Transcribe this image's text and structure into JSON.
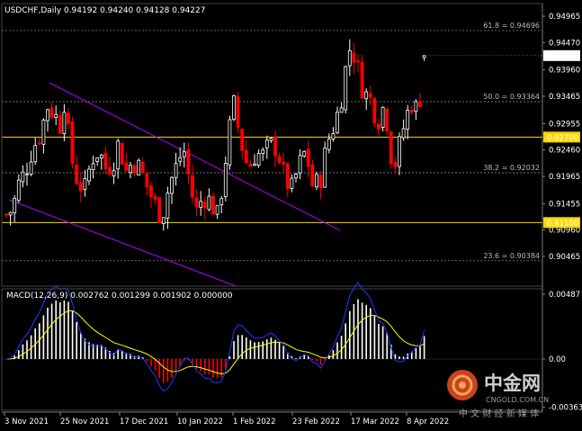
{
  "header": {
    "symbol_label": "USDCHF,Daily",
    "open": "0.94192",
    "high": "0.94240",
    "low": "0.94128",
    "close": "0.94227"
  },
  "price_axis": {
    "ticks": [
      "0.94965",
      "0.94470",
      "0.93960",
      "0.93465",
      "0.92955",
      "0.92460",
      "0.91965",
      "0.91455",
      "0.90960",
      "0.90465"
    ],
    "current_price": "0.94227",
    "level_labels": [
      "0.92700",
      "0.91100"
    ]
  },
  "fib_levels": [
    {
      "label": "61.8 = 0.94696",
      "value": 0.94696
    },
    {
      "label": "50.0 = 0.93364",
      "value": 0.93364
    },
    {
      "label": "38.2 = 0.92032",
      "value": 0.92032
    },
    {
      "label": "23.6 = 0.90384",
      "value": 0.90384
    }
  ],
  "horizontal_levels": [
    0.927,
    0.911
  ],
  "macd": {
    "label": "MACD(12,26,9) 0.002762 0.001299 0.001902 0.000000",
    "axis_ticks": [
      "0.00487",
      "0.00",
      "-0.003631"
    ]
  },
  "date_axis": [
    "3 Nov 2021",
    "25 Nov 2021",
    "17 Dec 2021",
    "10 Jan 2022",
    "1 Feb 2022",
    "23 Feb 2022",
    "17 Mar 2022",
    "8 Apr 2022"
  ],
  "watermark": {
    "title": "中金网",
    "domain": "CNGOLD.COM.CN",
    "slogan": "中 文 财 经 新 媒 体"
  },
  "colors": {
    "background": "#000000",
    "bull": "#ffffff",
    "bear": "#ff0000",
    "channel": "#b000ff",
    "level": "#ffd700",
    "macd_signal": "#ffff00",
    "macd_line": "#1a3cff"
  },
  "chart_data": {
    "type": "candlestick",
    "title": "USDCHF,Daily",
    "ylim": [
      0.9035,
      0.9512
    ],
    "x": [
      "3 Nov 2021",
      "25 Nov 2021",
      "17 Dec 2021",
      "10 Jan 2022",
      "1 Feb 2022",
      "23 Feb 2022",
      "17 Mar 2022",
      "8 Apr 2022"
    ],
    "last_values": {
      "open": 0.94192,
      "high": 0.9424,
      "low": 0.94128,
      "close": 0.94227
    }
  }
}
